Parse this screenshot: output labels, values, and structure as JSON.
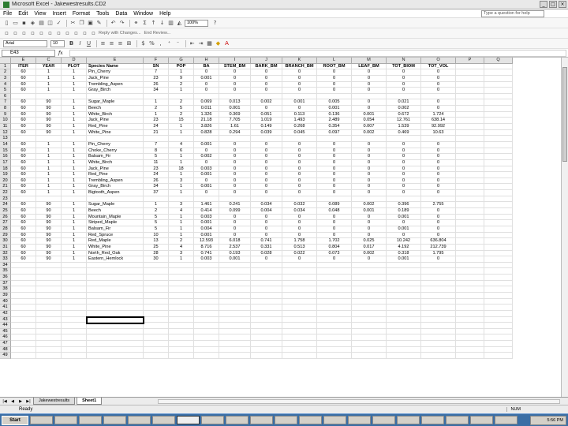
{
  "window": {
    "title": "Microsoft Excel - Jakewestresults.CD2",
    "controls": [
      "_",
      "□",
      "×"
    ]
  },
  "menu": {
    "items": [
      "File",
      "Edit",
      "View",
      "Insert",
      "Format",
      "Tools",
      "Data",
      "Window",
      "Help"
    ],
    "help_placeholder": "Type a question for help"
  },
  "toolbar": {
    "zoom": "100%",
    "reply_label": "Reply with Changes...",
    "end_review_label": "End Review...",
    "font_name": "Arial",
    "font_size": "10",
    "bold": "B",
    "italic": "I",
    "underline": "U",
    "dollar": "$",
    "percent": "%"
  },
  "formula_bar": {
    "name_box": "E43",
    "fx": "fx"
  },
  "columns": [
    "E",
    "C",
    "D",
    "E",
    "F",
    "G",
    "H",
    "I",
    "J",
    "K",
    "L",
    "M",
    "N",
    "O",
    "P",
    "Q"
  ],
  "header_row": [
    "ITER",
    "YEAR",
    "PLOT",
    "Species Name",
    "SN",
    "POP",
    "BA",
    "STEM_BM",
    "BARK_BM",
    "BRANCH_BM",
    "ROOT_BM",
    "LEAF_BM",
    "TOT_BIOM",
    "TOT_VOL",
    "",
    ""
  ],
  "rows": [
    [
      "60",
      "1",
      "1",
      "Pin_Cherry",
      "7",
      "1",
      "0",
      "0",
      "0",
      "0",
      "0",
      "0",
      "0",
      "0",
      "",
      ""
    ],
    [
      "60",
      "1",
      "1",
      "Jack_Pine",
      "23",
      "9",
      "0.001",
      "0",
      "0",
      "0",
      "0",
      "0",
      "0",
      "0",
      "",
      ""
    ],
    [
      "60",
      "1",
      "1",
      "Trembling_Aspen",
      "26",
      "2",
      "0",
      "0",
      "0",
      "0",
      "0",
      "0",
      "0",
      "0",
      "",
      ""
    ],
    [
      "60",
      "1",
      "1",
      "Gray_Birch",
      "34",
      "1",
      "0",
      "0",
      "0",
      "0",
      "0",
      "0",
      "0",
      "0",
      "",
      ""
    ],
    [
      "",
      "",
      "",
      "",
      "",
      "",
      "",
      "",
      "",
      "",
      "",
      "",
      "",
      "",
      "",
      ""
    ],
    [
      "60",
      "90",
      "1",
      "Sugar_Maple",
      "1",
      "2",
      "0.069",
      "0.013",
      "0.002",
      "0.001",
      "0.005",
      "0",
      "0.021",
      "0",
      "",
      ""
    ],
    [
      "60",
      "90",
      "1",
      "Beech",
      "2",
      "5",
      "0.011",
      "0.001",
      "0",
      "0",
      "0.001",
      "0",
      "0.002",
      "0",
      "",
      ""
    ],
    [
      "60",
      "90",
      "1",
      "White_Birch",
      "1",
      "2",
      "1.326",
      "0.369",
      "0.051",
      "0.113",
      "0.136",
      "0.001",
      "0.672",
      "1.724",
      "",
      ""
    ],
    [
      "60",
      "90",
      "1",
      "Jack_Pine",
      "23",
      "15",
      "21.18",
      "7.705",
      "1.019",
      "1.493",
      "2.489",
      "0.054",
      "12.761",
      "638.14",
      "",
      ""
    ],
    [
      "60",
      "90",
      "1",
      "Red_Pine",
      "24",
      "1",
      "3.826",
      "1.61",
      "0.149",
      "0.268",
      "0.354",
      "0.007",
      "1.539",
      "92.992",
      "",
      ""
    ],
    [
      "60",
      "90",
      "1",
      "White_Pine",
      "21",
      "1",
      "0.828",
      "0.294",
      "0.039",
      "0.045",
      "0.097",
      "0.002",
      "0.469",
      "10.63",
      "",
      ""
    ],
    [
      "",
      "",
      "",
      "",
      "",
      "",
      "",
      "",
      "",
      "",
      "",
      "",
      "",
      "",
      "",
      ""
    ],
    [
      "60",
      "1",
      "1",
      "Pin_Cherry",
      "7",
      "4",
      "0.001",
      "0",
      "0",
      "0",
      "0",
      "0",
      "0",
      "0",
      "",
      ""
    ],
    [
      "60",
      "1",
      "1",
      "Choke_Cherry",
      "8",
      "6",
      "0",
      "0",
      "0",
      "0",
      "0",
      "0",
      "0",
      "0",
      "",
      ""
    ],
    [
      "60",
      "1",
      "1",
      "Balsam_Fir",
      "5",
      "1",
      "0.002",
      "0",
      "0",
      "0",
      "0",
      "0",
      "0",
      "0",
      "",
      ""
    ],
    [
      "60",
      "1",
      "1",
      "White_Birch",
      "11",
      "1",
      "0",
      "0",
      "0",
      "0",
      "0",
      "0",
      "0",
      "0",
      "",
      ""
    ],
    [
      "60",
      "1",
      "1",
      "Jack_Pine",
      "23",
      "18",
      "0.003",
      "0",
      "0",
      "0",
      "0",
      "0",
      "0",
      "0",
      "",
      ""
    ],
    [
      "60",
      "1",
      "1",
      "Red_Pine",
      "24",
      "1",
      "0.001",
      "0",
      "0",
      "0",
      "0",
      "0",
      "0",
      "0",
      "",
      ""
    ],
    [
      "60",
      "1",
      "1",
      "Trembling_Aspen",
      "26",
      "3",
      "0",
      "0",
      "0",
      "0",
      "0",
      "0",
      "0",
      "0",
      "",
      ""
    ],
    [
      "60",
      "1",
      "1",
      "Gray_Birch",
      "34",
      "1",
      "0.001",
      "0",
      "0",
      "0",
      "0",
      "0",
      "0",
      "0",
      "",
      ""
    ],
    [
      "60",
      "1",
      "1",
      "Bigtooth_Aspen",
      "37",
      "1",
      "0",
      "0",
      "0",
      "0",
      "0",
      "0",
      "0",
      "0",
      "",
      ""
    ],
    [
      "",
      "",
      "",
      "",
      "",
      "",
      "",
      "",
      "",
      "",
      "",
      "",
      "",
      "",
      "",
      ""
    ],
    [
      "60",
      "90",
      "1",
      "Sugar_Maple",
      "1",
      "3",
      "1.461",
      "0.241",
      "0.034",
      "0.032",
      "0.089",
      "0.002",
      "0.396",
      "2.755",
      "",
      ""
    ],
    [
      "60",
      "90",
      "1",
      "Beech",
      "2",
      "4",
      "0.414",
      "0.099",
      "0.004",
      "0.034",
      "0.048",
      "0.001",
      "0.189",
      "0",
      "",
      ""
    ],
    [
      "60",
      "90",
      "1",
      "Mountain_Maple",
      "5",
      "1",
      "0.003",
      "0",
      "0",
      "0",
      "0",
      "0",
      "0.001",
      "0",
      "",
      ""
    ],
    [
      "60",
      "90",
      "1",
      "Striped_Maple",
      "5",
      "1",
      "0.001",
      "0",
      "0",
      "0",
      "0",
      "0",
      "0",
      "0",
      "",
      ""
    ],
    [
      "60",
      "90",
      "1",
      "Balsam_Fir",
      "5",
      "1",
      "0.004",
      "0",
      "0",
      "0",
      "0",
      "0",
      "0.001",
      "0",
      "",
      ""
    ],
    [
      "60",
      "90",
      "1",
      "Red_Spruce",
      "10",
      "1",
      "0.001",
      "0",
      "0",
      "0",
      "0",
      "0",
      "0",
      "0",
      "",
      ""
    ],
    [
      "60",
      "90",
      "1",
      "Red_Maple",
      "13",
      "2",
      "12.593",
      "6.018",
      "0.741",
      "1.758",
      "1.702",
      "0.025",
      "10.242",
      "636.804",
      "",
      ""
    ],
    [
      "60",
      "90",
      "1",
      "White_Pine",
      "25",
      "4",
      "8.716",
      "2.537",
      "0.331",
      "0.513",
      "0.804",
      "0.017",
      "4.192",
      "212.739",
      "",
      ""
    ],
    [
      "60",
      "90",
      "1",
      "North_Red_Oak",
      "28",
      "3",
      "0.741",
      "0.193",
      "0.028",
      "0.022",
      "0.073",
      "0.002",
      "0.318",
      "1.795",
      "",
      ""
    ],
    [
      "60",
      "90",
      "1",
      "Eastern_Hemlock",
      "30",
      "1",
      "0.003",
      "0.001",
      "0",
      "0",
      "0",
      "0",
      "0.001",
      "0",
      "",
      ""
    ]
  ],
  "empty_row_numbers": [
    "34",
    "35",
    "36",
    "37",
    "38",
    "39",
    "40",
    "41",
    "42",
    "43",
    "44",
    "45",
    "46",
    "47",
    "48",
    "49"
  ],
  "sheet_tabs": [
    "Jakewestresults",
    "Sheet1"
  ],
  "status": {
    "left": "Ready",
    "num": "NUM"
  },
  "taskbar": {
    "start": "Start",
    "items": [
      "",
      "",
      "",
      "",
      "",
      "",
      "",
      "",
      "",
      "",
      "",
      "",
      "",
      "",
      "",
      "",
      "",
      "",
      "",
      ""
    ],
    "clock": "5:56 PM"
  }
}
